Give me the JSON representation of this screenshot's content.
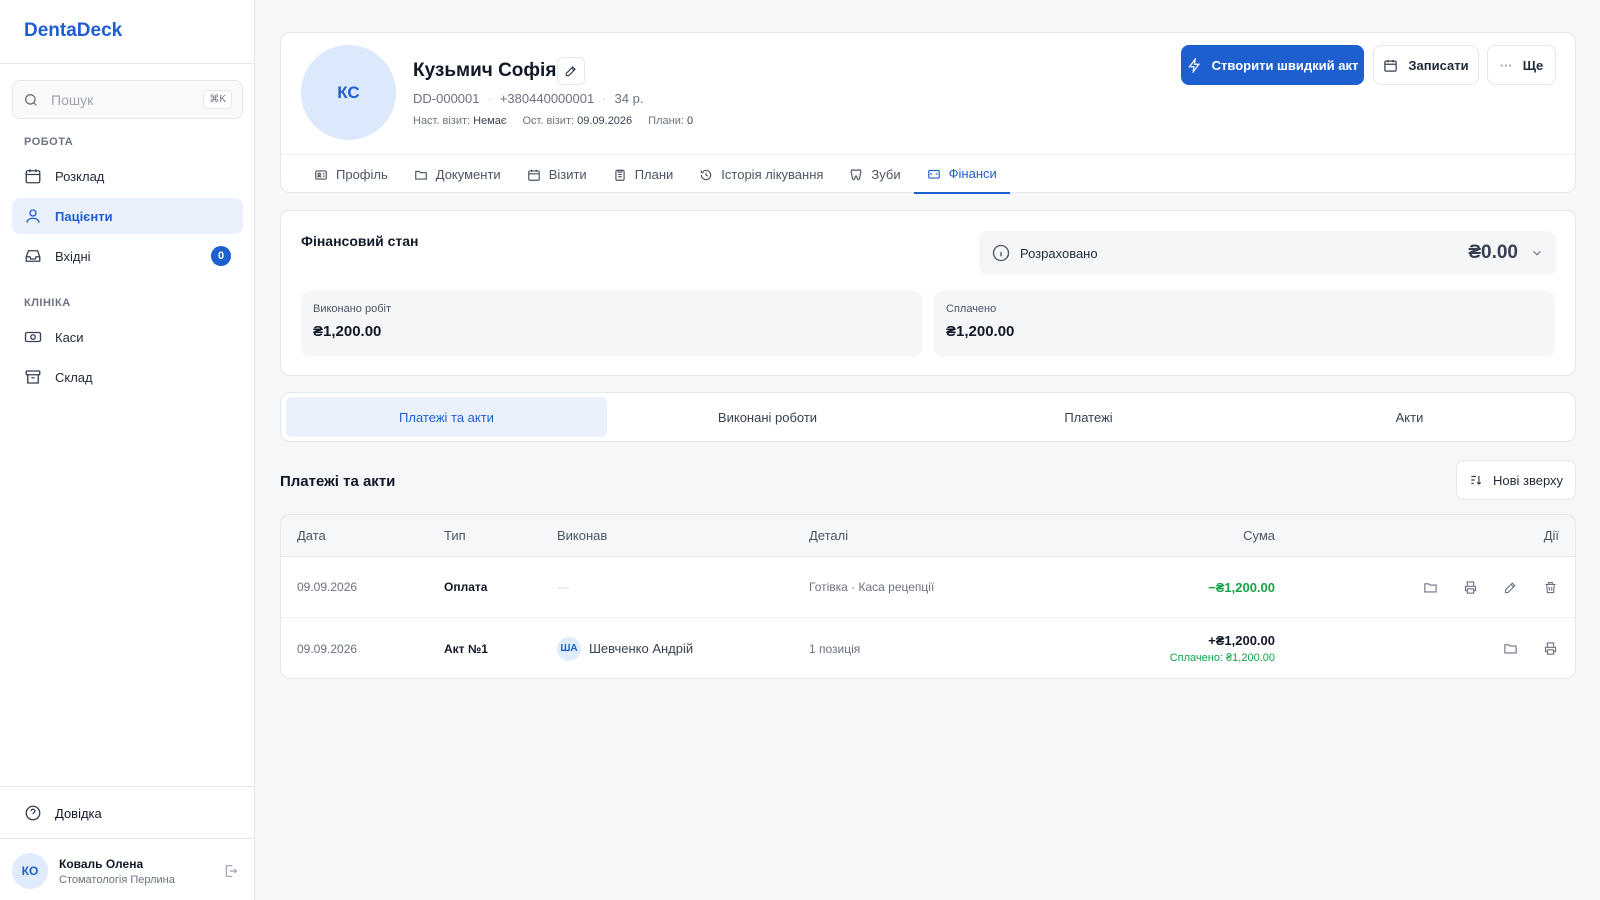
{
  "app": {
    "name": "DentaDeck"
  },
  "search": {
    "placeholder": "Пошук",
    "shortcut": "⌘K"
  },
  "sidebar": {
    "section_work": "РОБОТА",
    "section_clinic": "КЛІНІКА",
    "items": [
      {
        "label": "Розклад",
        "icon": "calendar-icon"
      },
      {
        "label": "Пацієнти",
        "icon": "users-icon",
        "active": true
      },
      {
        "label": "Вхідні",
        "icon": "inbox-icon",
        "badge": "0"
      },
      {
        "label": "Каси",
        "icon": "cash-register-icon"
      },
      {
        "label": "Склад",
        "icon": "archive-icon"
      }
    ],
    "help": "Довідка"
  },
  "user": {
    "initials": "КО",
    "name": "Коваль Олена",
    "org": "Стоматологія Перлина"
  },
  "patient": {
    "initials": "КС",
    "name": "Кузьмич Софія",
    "id": "DD-000001",
    "phone": "+380440000001",
    "age": "34 р.",
    "next_visit_label": "Наст. візит:",
    "next_visit": "Немає",
    "last_visit_label": "Ост. візит:",
    "last_visit": "09.09.2026",
    "plans_label": "Плани:",
    "plans": "0"
  },
  "actions": {
    "quick_act": "Створити швидкий акт",
    "book": "Записати",
    "more": "Ще"
  },
  "tabs": [
    {
      "label": "Профіль"
    },
    {
      "label": "Документи"
    },
    {
      "label": "Візити"
    },
    {
      "label": "Плани"
    },
    {
      "label": "Історія лікування"
    },
    {
      "label": "Зуби"
    },
    {
      "label": "Фінанси",
      "active": true
    }
  ],
  "finance": {
    "title": "Фінансовий стан",
    "status_label": "Розраховано",
    "balance": "₴0.00",
    "done_label": "Виконано робіт",
    "done_value": "₴1,200.00",
    "paid_label": "Сплачено",
    "paid_value": "₴1,200.00"
  },
  "subtabs": [
    {
      "label": "Платежі та акти",
      "active": true
    },
    {
      "label": "Виконані роботи"
    },
    {
      "label": "Платежі"
    },
    {
      "label": "Акти"
    }
  ],
  "list": {
    "title": "Платежі та акти",
    "sort_label": "Нові зверху"
  },
  "table": {
    "headers": {
      "date": "Дата",
      "type": "Тип",
      "by": "Виконав",
      "details": "Деталі",
      "sum": "Сума",
      "actions": "Дії"
    },
    "rows": [
      {
        "date": "09.09.2026",
        "type": "Оплата",
        "by": "—",
        "details": "Готівка · Каса рецепції",
        "sum": "−₴1,200.00"
      },
      {
        "date": "09.09.2026",
        "type": "Акт №1",
        "by_initials": "ША",
        "by": "Шевченко Андрій",
        "details": "1 позиція",
        "sum": "+₴1,200.00",
        "paid_note": "Сплачено: ₴1,200.00"
      }
    ]
  },
  "colors": {
    "accent": "#1d5fcf",
    "positive": "#16a34a"
  }
}
